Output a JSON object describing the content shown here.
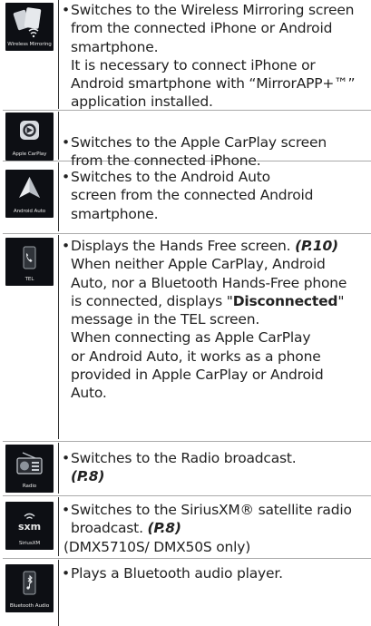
{
  "bullet": "•",
  "rows": [
    {
      "icon_label": "Wireless Mirroring",
      "icon": "wireless-mirroring-icon",
      "lines": [
        "Switches to the Wireless Mirroring screen",
        "from the connected iPhone or Android",
        "smartphone.",
        "It is necessary to connect iPhone or",
        "Android smartphone with “MirrorAPP+™”",
        "application installed."
      ]
    },
    {
      "icon_label": "Apple CarPlay",
      "icon": "apple-carplay-icon",
      "lines": [
        "Switches to the Apple CarPlay screen",
        "from the connected iPhone."
      ]
    },
    {
      "icon_label": "Android Auto",
      "icon": "android-auto-icon",
      "lines": [
        "Switches to the Android Auto",
        "screen from the connected Android",
        "smartphone."
      ]
    },
    {
      "icon_label": "TEL",
      "icon": "phone-icon",
      "line1_text": "Displays the Hands Free screen. ",
      "line1_ref": "(P.10)",
      "lines_a": [
        "When neither Apple CarPlay, Android",
        "Auto, nor a Bluetooth Hands-Free phone"
      ],
      "line4_pre": "is connected, displays \"",
      "line4_bold": "Disconnected",
      "line4_post": "\"",
      "lines_b": [
        "message in the TEL screen.",
        "When connecting as Apple CarPlay",
        "or Android Auto, it works as a phone",
        "provided in Apple CarPlay or Android",
        "Auto."
      ]
    },
    {
      "icon_label": "Radio",
      "icon": "radio-icon",
      "line1": "Switches to the Radio broadcast.",
      "ref": "(P.8)"
    },
    {
      "icon_label": "SiriusXM",
      "icon": "siriusxm-icon",
      "logo_text": "sxm",
      "line1": "Switches to the SiriusXM® satellite radio",
      "line2": "broadcast. ",
      "ref": "(P.8)",
      "note": "(DMX5710S/ DMX50S only)"
    },
    {
      "icon_label": "Bluetooth Audio",
      "icon": "bluetooth-audio-icon",
      "line1": "Plays a Bluetooth audio player."
    }
  ]
}
